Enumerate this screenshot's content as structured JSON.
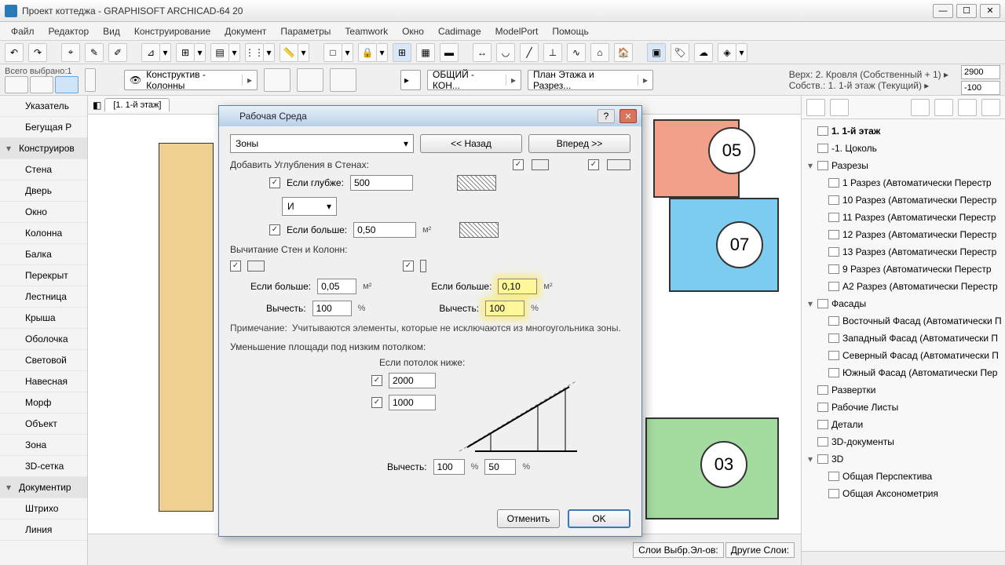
{
  "titlebar": {
    "title": "Проект коттеджа - GRAPHISOFT ARCHICAD-64 20"
  },
  "menu": [
    "Файл",
    "Редактор",
    "Вид",
    "Конструирование",
    "Документ",
    "Параметры",
    "Teamwork",
    "Окно",
    "Cadimage",
    "ModelPort",
    "Помощь"
  ],
  "toolbar2": {
    "selected_label": "Всего выбрано:1",
    "combo1": "Конструктив - Колонны",
    "combo2": "ОБЩИЙ - КОН...",
    "combo3": "План Этажа и Разрез...",
    "top_label": "Верх:",
    "top_val": "2. Кровля (Собственный + 1)",
    "own_label": "Собств.:",
    "own_val": "1. 1-й этаж (Текущий)",
    "h1": "2900",
    "h2": "-100"
  },
  "leftpanel": [
    {
      "t": "Указатель",
      "h": false
    },
    {
      "t": "Бегущая Р",
      "h": false
    },
    {
      "t": "Конструиров",
      "h": true
    },
    {
      "t": "Стена",
      "h": false
    },
    {
      "t": "Дверь",
      "h": false
    },
    {
      "t": "Окно",
      "h": false
    },
    {
      "t": "Колонна",
      "h": false
    },
    {
      "t": "Балка",
      "h": false
    },
    {
      "t": "Перекрыт",
      "h": false
    },
    {
      "t": "Лестница",
      "h": false
    },
    {
      "t": "Крыша",
      "h": false
    },
    {
      "t": "Оболочка",
      "h": false
    },
    {
      "t": "Световой",
      "h": false
    },
    {
      "t": "Навесная",
      "h": false
    },
    {
      "t": "Морф",
      "h": false
    },
    {
      "t": "Объект",
      "h": false
    },
    {
      "t": "Зона",
      "h": false
    },
    {
      "t": "3D-сетка",
      "h": false
    },
    {
      "t": "Документир",
      "h": true
    },
    {
      "t": "Штрихо",
      "h": false
    },
    {
      "t": "Линия",
      "h": false
    }
  ],
  "canvas": {
    "tab": "[1. 1-й этаж]",
    "zones": {
      "z05": "05",
      "z07": "07",
      "z03": "03"
    }
  },
  "rightpanel": {
    "root": "1. 1-й этаж",
    "sub": "-1. Цоколь",
    "grp1": "Разрезы",
    "items1": [
      "1 Разрез (Автоматически Перестр",
      "10 Разрез (Автоматически Перестр",
      "11 Разрез (Автоматически Перестр",
      "12 Разрез (Автоматически Перестр",
      "13 Разрез (Автоматически Перестр",
      "9 Разрез (Автоматически Перестр",
      "А2 Разрез (Автоматически Перестр"
    ],
    "grp2": "Фасады",
    "items2": [
      "Восточный Фасад (Автоматически П",
      "Западный Фасад (Автоматически П",
      "Северный Фасад (Автоматически П",
      "Южный Фасад (Автоматически Пер"
    ],
    "flat": [
      "Развертки",
      "Рабочие Листы",
      "Детали",
      "3D-документы"
    ],
    "grp3": "3D",
    "items3": [
      "Общая Перспектива",
      "Общая Аксонометрия"
    ]
  },
  "bottom": {
    "l1": "Слои Выбр.Эл-ов:",
    "l2": "Другие Слои:"
  },
  "dialog": {
    "title": "Рабочая Среда",
    "dropdown": "Зоны",
    "back": "<< Назад",
    "fwd": "Вперед >>",
    "sec1": "Добавить Углубления в Стенах:",
    "deeper": "Если глубже:",
    "deeper_v": "500",
    "andor": "И",
    "bigger": "Если больше:",
    "bigger_v": "0,50",
    "m2": "м²",
    "sec2": "Вычитание Стен и Колонн:",
    "wall_bigger_v": "0,05",
    "col_bigger_v": "0,10",
    "subtract": "Вычесть:",
    "sub_wall": "100",
    "sub_col": "100",
    "pct": "%",
    "note_l": "Примечание:",
    "note": "Учитываются элементы, которые не исключаются из многоугольника зоны.",
    "sec3": "Уменьшение площади под низким потолком:",
    "sec3b": "Если потолок ниже:",
    "h1": "2000",
    "h2": "1000",
    "sub3a": "100",
    "sub3b": "50",
    "cancel": "Отменить",
    "ok": "OK"
  }
}
